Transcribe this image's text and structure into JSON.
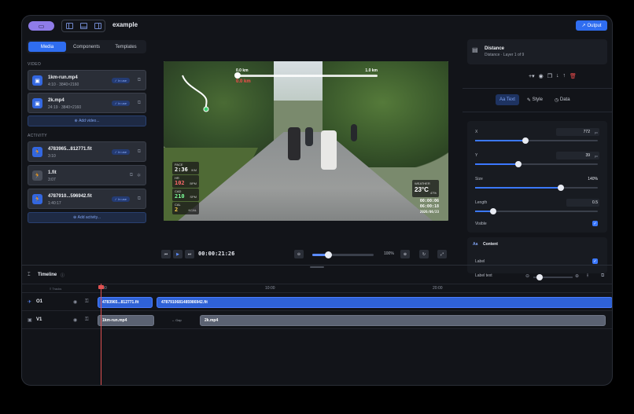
{
  "app": {
    "project_title": "example",
    "output_label": "Output"
  },
  "left": {
    "tabs": [
      "Media",
      "Components",
      "Templates"
    ],
    "video_label": "VIDEO",
    "videos": [
      {
        "name": "1km-run.mp4",
        "meta": "4:10 · 3840×2160",
        "badge": "✓ In use"
      },
      {
        "name": "2k.mp4",
        "meta": "24:19 · 3840×2160",
        "badge": "✓ In use"
      }
    ],
    "add_video": "Add video...",
    "activity_label": "ACTIVITY",
    "activities": [
      {
        "name": "4783965...812771.fit",
        "meta": "3:10",
        "badge": "✓ In use"
      },
      {
        "name": "1.fit",
        "meta": "3:07",
        "badge": ""
      },
      {
        "name": "4787910...596942.fit",
        "meta": "1:40:17",
        "badge": "✓ In use"
      }
    ],
    "add_activity": "Add activity..."
  },
  "preview": {
    "dist_start": "0.0 km",
    "dist_end": "1.0 km",
    "dist_current": "0.0 km",
    "stats": [
      {
        "k": "PACE",
        "v": "2:36",
        "u": "/KM"
      },
      {
        "k": "HR",
        "v": "102",
        "u": "BPM"
      },
      {
        "k": "CAD",
        "v": "210",
        "u": "SPM"
      },
      {
        "k": "CAL",
        "v": "2",
        "u": "KCAL"
      }
    ],
    "weather_label": "WEATHER",
    "weather_temp": "23°C",
    "weather_pct": "47%",
    "elapsed": "00:00:06",
    "clock": "06:00:18",
    "date": "2026/06/23"
  },
  "playback": {
    "timecode": "00:00:21:26",
    "zoom_pct": "100%",
    "zoom_fraction": 0.25
  },
  "right": {
    "layer_title": "Distance",
    "layer_sub": "Distance · Layer 1 of 9",
    "tabs": [
      "Aa Text",
      "Style",
      "Data"
    ],
    "props": [
      {
        "label": "X",
        "value": "772",
        "unit": "px",
        "fraction": 0.41
      },
      {
        "label": "Y",
        "value": "39",
        "unit": "px",
        "fraction": 0.35
      },
      {
        "label": "Size",
        "value": "140%",
        "unit": "",
        "fraction": 0.7
      },
      {
        "label": "Length",
        "value": "0.5",
        "unit": "",
        "fraction": 0.15
      }
    ],
    "visible_label": "Visible",
    "content_tag": "Aa",
    "content_title": "Content",
    "label_label": "Label",
    "label_text": "Label text"
  },
  "timeline": {
    "title": "Timeline",
    "tracks_label": "Tracks",
    "ticks": [
      "0:00",
      "10:00",
      "20:00"
    ],
    "track_o1": "O1",
    "track_v1": "V1",
    "o1_clips": [
      "4783965...812771.fit",
      "4787910681485986942.fit"
    ],
    "v1_clips": [
      "1km-run.mp4",
      "2k.mp4"
    ],
    "gap_label": "↔ Gap"
  }
}
